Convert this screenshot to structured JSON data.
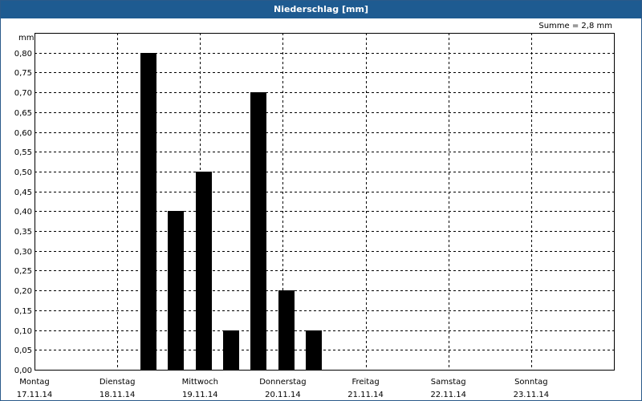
{
  "window": {
    "title": "Niederschlag [mm]"
  },
  "chart_data": {
    "type": "bar",
    "title": "Niederschlag [mm]",
    "ylabel": "mm",
    "ylim": [
      0,
      0.85
    ],
    "y_ticks": [
      "0,00",
      "0,05",
      "0,10",
      "0,15",
      "0,20",
      "0,25",
      "0,30",
      "0,35",
      "0,40",
      "0,45",
      "0,50",
      "0,55",
      "0,60",
      "0,65",
      "0,70",
      "0,75",
      "0,80"
    ],
    "summary": "Summe = 2,8 mm",
    "days": [
      {
        "name": "Montag",
        "date": "17.11.14"
      },
      {
        "name": "Dienstag",
        "date": "18.11.14"
      },
      {
        "name": "Mittwoch",
        "date": "19.11.14"
      },
      {
        "name": "Donnerstag",
        "date": "20.11.14"
      },
      {
        "name": "Freitag",
        "date": "21.11.14"
      },
      {
        "name": "Samstag",
        "date": "22.11.14"
      },
      {
        "name": "Sonntag",
        "date": "23.11.14"
      }
    ],
    "bars": [
      {
        "day": "Dienstag",
        "hour": 9,
        "value": 0.8
      },
      {
        "day": "Dienstag",
        "hour": 17,
        "value": 0.4
      },
      {
        "day": "Mittwoch",
        "hour": 1,
        "value": 0.5
      },
      {
        "day": "Mittwoch",
        "hour": 9,
        "value": 0.1
      },
      {
        "day": "Mittwoch",
        "hour": 17,
        "value": 0.7
      },
      {
        "day": "Donnerstag",
        "hour": 1,
        "value": 0.2
      },
      {
        "day": "Donnerstag",
        "hour": 9,
        "value": 0.1
      }
    ],
    "grid": true,
    "colors": {
      "bar": "#000000",
      "grid": "#000000",
      "title_bg": "#1e5b91"
    }
  }
}
